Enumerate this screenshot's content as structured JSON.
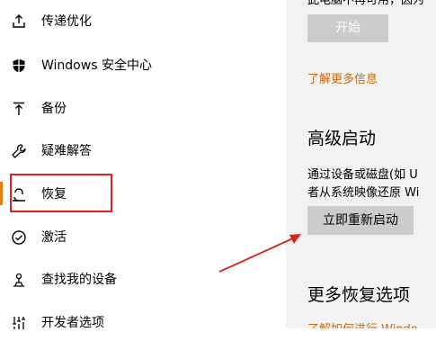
{
  "sidebar": {
    "items": [
      {
        "label": "传递优化",
        "icon": "upload-icon"
      },
      {
        "label": "Windows 安全中心",
        "icon": "shield-icon"
      },
      {
        "label": "备份",
        "icon": "arrow-up-icon"
      },
      {
        "label": "疑难解答",
        "icon": "wrench-icon"
      },
      {
        "label": "恢复",
        "icon": "recovery-icon"
      },
      {
        "label": "激活",
        "icon": "check-circle-icon"
      },
      {
        "label": "查找我的设备",
        "icon": "find-device-icon"
      },
      {
        "label": "开发者选项",
        "icon": "developer-icon"
      }
    ],
    "active_index": 4
  },
  "content": {
    "top_partial_text": "此电脑不再可用，因为",
    "start_button_label": "开始",
    "learn_more_link": "了解更多信息",
    "advanced_startup": {
      "heading": "高级启动",
      "description_line1": "通过设备或磁盘(如 U",
      "description_line2": "者从系统映像还原 Wi",
      "restart_button_label": "立即重新启动"
    },
    "more_options": {
      "heading": "更多恢复选项",
      "link_partial": "了解如何进行 Windo"
    }
  },
  "colors": {
    "accent": "#e87d10",
    "link": "#c46a14",
    "annotation_red": "#e0201f",
    "content_bg": "#f2f2f2",
    "button_bg": "#cccccc"
  }
}
